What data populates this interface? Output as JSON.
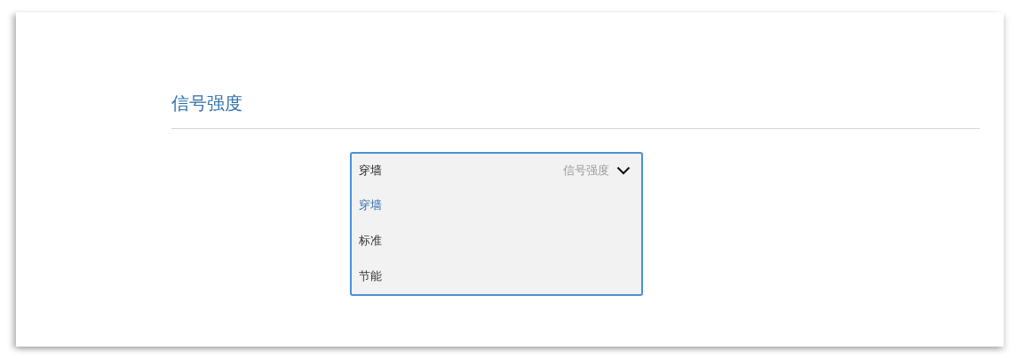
{
  "section": {
    "title": "信号强度"
  },
  "select": {
    "value": "穿墙",
    "label": "信号强度",
    "expanded": true,
    "options": [
      {
        "label": "穿墙",
        "selected": true
      },
      {
        "label": "标准",
        "selected": false
      },
      {
        "label": "节能",
        "selected": false
      }
    ]
  }
}
